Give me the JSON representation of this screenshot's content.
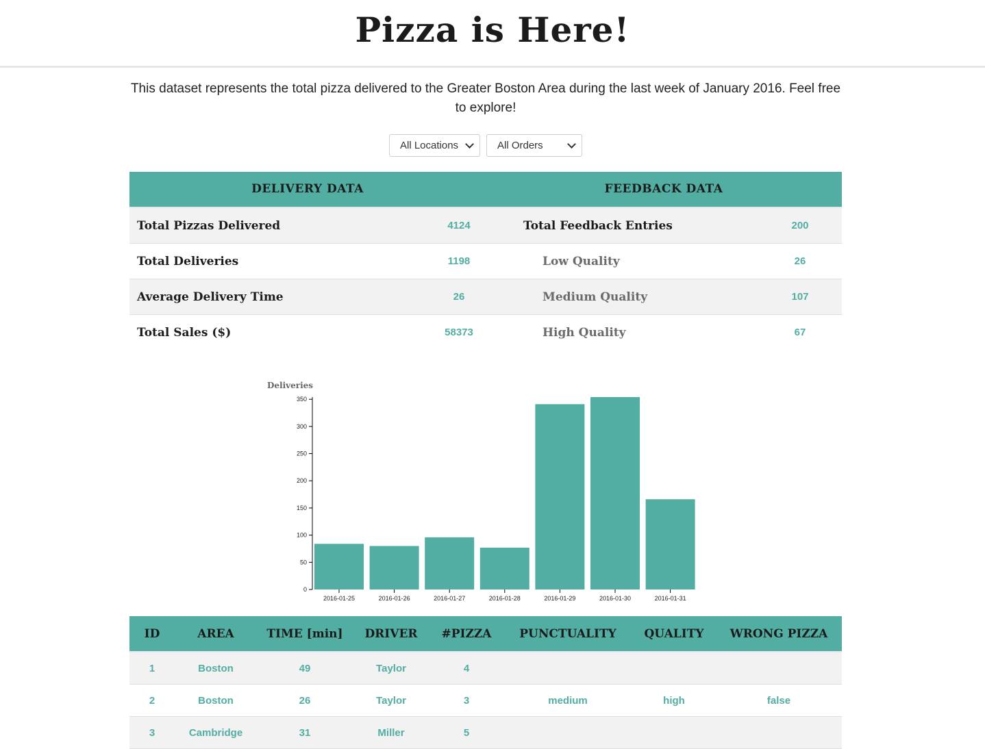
{
  "header": {
    "title": "Pizza is Here!"
  },
  "intro": {
    "text": "This dataset represents the total pizza delivered to the Greater Boston Area during the last week of January 2016. Feel free to explore!"
  },
  "filters": {
    "location": {
      "selected": "All Locations"
    },
    "orders": {
      "selected": "All Orders"
    }
  },
  "stats": {
    "delivery_header": "DELIVERY DATA",
    "feedback_header": "FEEDBACK DATA",
    "rows": [
      {
        "d_label": "Total Pizzas Delivered",
        "d_value": "4124",
        "f_label": "Total Feedback Entries",
        "f_value": "200"
      },
      {
        "d_label": "Total Deliveries",
        "d_value": "1198",
        "f_label": "Low Quality",
        "f_value": "26"
      },
      {
        "d_label": "Average Delivery Time",
        "d_value": "26",
        "f_label": "Medium Quality",
        "f_value": "107"
      },
      {
        "d_label": "Total Sales ($)",
        "d_value": "58373",
        "f_label": "High Quality",
        "f_value": "67"
      }
    ]
  },
  "chart_data": {
    "type": "bar",
    "ylabel": "Deliveries",
    "categories": [
      "2016-01-25",
      "2016-01-26",
      "2016-01-27",
      "2016-01-28",
      "2016-01-29",
      "2016-01-30",
      "2016-01-31"
    ],
    "values": [
      84,
      80,
      96,
      77,
      341,
      354,
      166
    ],
    "yticks": [
      0,
      50,
      100,
      150,
      200,
      250,
      300,
      350
    ],
    "ylim": [
      0,
      354
    ],
    "color": "#52aea3"
  },
  "table": {
    "headers": [
      "ID",
      "AREA",
      "TIME [min]",
      "DRIVER",
      "#PIZZA",
      "PUNCTUALITY",
      "QUALITY",
      "WRONG PIZZA"
    ],
    "rows": [
      [
        "1",
        "Boston",
        "49",
        "Taylor",
        "4",
        "",
        "",
        ""
      ],
      [
        "2",
        "Boston",
        "26",
        "Taylor",
        "3",
        "medium",
        "high",
        "false"
      ],
      [
        "3",
        "Cambridge",
        "31",
        "Miller",
        "5",
        "",
        "",
        ""
      ]
    ]
  },
  "colors": {
    "accent": "#52aea3",
    "row_alt": "#f2f2f2"
  }
}
